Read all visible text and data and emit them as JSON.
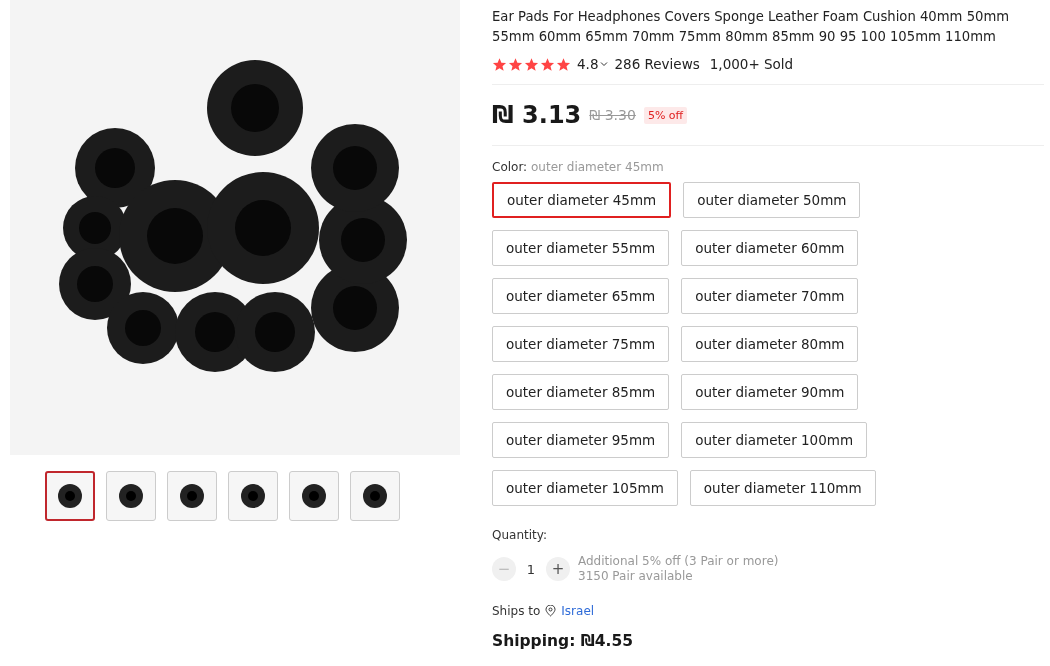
{
  "gallery": {
    "thumbnails": [
      {
        "selected": true
      },
      {
        "selected": false
      },
      {
        "selected": false
      },
      {
        "selected": false
      },
      {
        "selected": false
      },
      {
        "selected": false
      }
    ]
  },
  "product": {
    "title": "Ear Pads For Headphones Covers Sponge Leather Foam Cushion 40mm 50mm 55mm 60mm 65mm 70mm 75mm 80mm 85mm 90 95 100 105mm 110mm",
    "stars": 5,
    "rating": "4.8",
    "reviews": "286 Reviews",
    "sold": "1,000+ Sold"
  },
  "price": {
    "current": "₪ 3.13",
    "original": "₪ 3.30",
    "discount": "5% off"
  },
  "color": {
    "label": "Color:",
    "value": "outer diameter 45mm",
    "options": [
      {
        "label": "outer diameter 45mm",
        "selected": true
      },
      {
        "label": "outer diameter 50mm",
        "selected": false
      },
      {
        "label": "outer diameter 55mm",
        "selected": false
      },
      {
        "label": "outer diameter 60mm",
        "selected": false
      },
      {
        "label": "outer diameter 65mm",
        "selected": false
      },
      {
        "label": "outer diameter 70mm",
        "selected": false
      },
      {
        "label": "outer diameter 75mm",
        "selected": false
      },
      {
        "label": "outer diameter 80mm",
        "selected": false
      },
      {
        "label": "outer diameter 85mm",
        "selected": false
      },
      {
        "label": "outer diameter 90mm",
        "selected": false
      },
      {
        "label": "outer diameter 95mm",
        "selected": false
      },
      {
        "label": "outer diameter 100mm",
        "selected": false
      },
      {
        "label": "outer diameter 105mm",
        "selected": false
      },
      {
        "label": "outer diameter 110mm",
        "selected": false
      }
    ]
  },
  "quantity": {
    "label": "Quantity:",
    "minus": "−",
    "value": "1",
    "plus": "+",
    "note": "Additional 5% off (3 Pair or more)",
    "available": "3150 Pair available"
  },
  "ships_to": {
    "label": "Ships to",
    "country": "Israel"
  },
  "shipping": "Shipping: ₪4.55"
}
